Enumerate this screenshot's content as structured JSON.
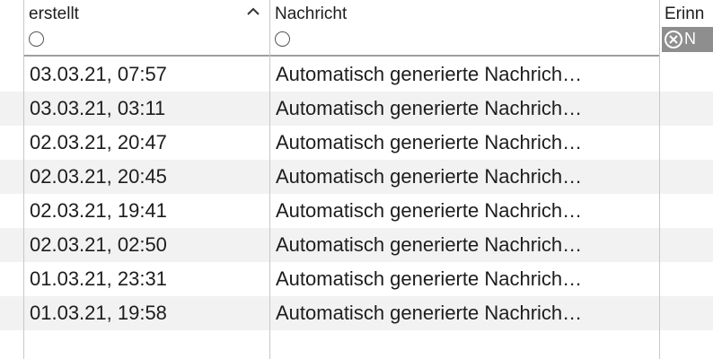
{
  "columns": {
    "created": {
      "title": "erstellt",
      "sort_icon": "chevron-up-icon",
      "filter_icon": "radio-empty-icon"
    },
    "message": {
      "title": "Nachricht",
      "filter_icon": "radio-empty-icon"
    },
    "reminder": {
      "title": "Erinn",
      "filter_chip_icon": "circle-x-icon",
      "filter_chip_text": "N"
    }
  },
  "rows": [
    {
      "created": "03.03.21, 07:57",
      "message": "Automatisch generierte Nachrich…"
    },
    {
      "created": "03.03.21, 03:11",
      "message": "Automatisch generierte Nachrich…"
    },
    {
      "created": "02.03.21, 20:47",
      "message": "Automatisch generierte Nachrich…"
    },
    {
      "created": "02.03.21, 20:45",
      "message": "Automatisch generierte Nachrich…"
    },
    {
      "created": "02.03.21, 19:41",
      "message": "Automatisch generierte Nachrich…"
    },
    {
      "created": "02.03.21, 02:50",
      "message": "Automatisch generierte Nachrich…"
    },
    {
      "created": "01.03.21, 23:31",
      "message": "Automatisch generierte Nachrich…"
    },
    {
      "created": "01.03.21, 19:58",
      "message": "Automatisch generierte Nachrich…"
    }
  ],
  "colors": {
    "row_alt": "#f2f2f2",
    "chip_bg": "#8e8e8e",
    "divider": "#c8c8c8"
  }
}
